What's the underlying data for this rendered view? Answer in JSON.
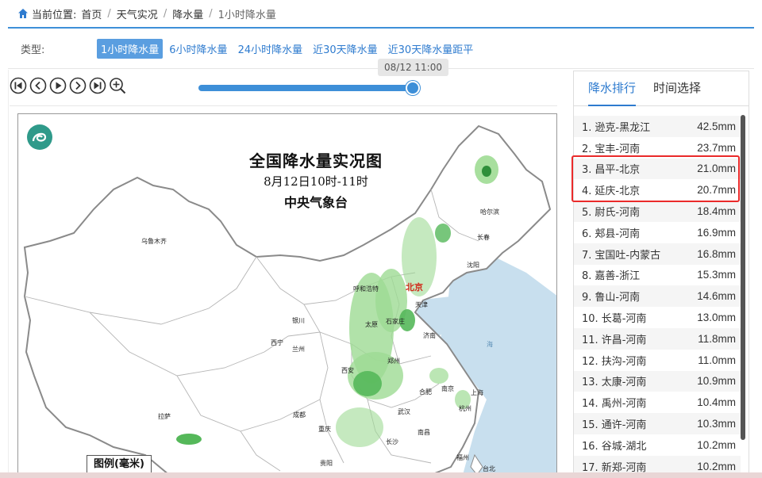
{
  "breadcrumb": {
    "prefix": "当前位置:",
    "items": [
      "首页",
      "天气实况",
      "降水量",
      "1小时降水量"
    ],
    "separator": "/"
  },
  "types": {
    "label": "类型:",
    "options": [
      "1小时降水量",
      "6小时降水量",
      "24小时降水量",
      "近30天降水量",
      "近30天降水量距平"
    ],
    "active_index": 0
  },
  "player": {
    "time_tip": "08/12 11:00",
    "slider_progress": 1.0
  },
  "map": {
    "title": "全国降水量实况图",
    "subtitle": "8月12日10时-11时",
    "agency": "中央气象台",
    "legend_title": "图例(毫米)",
    "cities": [
      "乌鲁木齐",
      "哈尔滨",
      "长春",
      "沈阳",
      "呼和浩特",
      "北京",
      "天津",
      "银川",
      "太原",
      "石家庄",
      "西宁",
      "兰州",
      "济南",
      "郑州",
      "西安",
      "合肥",
      "南京",
      "上海",
      "拉萨",
      "成都",
      "武汉",
      "杭州",
      "重庆",
      "长沙",
      "南昌",
      "贵阳",
      "福州",
      "台北"
    ],
    "capital": "北京",
    "sea_label": "海",
    "colors": {
      "rain_light": "#9edb94",
      "rain_mid": "#55b85a",
      "rain_dark": "#2f8f3a",
      "sea": "#c8dfee",
      "border": "#8a8a8a"
    }
  },
  "panel": {
    "tabs": [
      "降水排行",
      "时间选择"
    ],
    "active_tab": 0,
    "ranking": [
      {
        "rank": "1.",
        "station": "逊克-黑龙江",
        "value": "42.5mm"
      },
      {
        "rank": "2.",
        "station": "宝丰-河南",
        "value": "23.7mm"
      },
      {
        "rank": "3.",
        "station": "昌平-北京",
        "value": "21.0mm"
      },
      {
        "rank": "4.",
        "station": "延庆-北京",
        "value": "20.7mm"
      },
      {
        "rank": "5.",
        "station": "尉氏-河南",
        "value": "18.4mm"
      },
      {
        "rank": "6.",
        "station": "郏县-河南",
        "value": "16.9mm"
      },
      {
        "rank": "7.",
        "station": "宝国吐-内蒙古",
        "value": "16.8mm"
      },
      {
        "rank": "8.",
        "station": "嘉善-浙江",
        "value": "15.3mm"
      },
      {
        "rank": "9.",
        "station": "鲁山-河南",
        "value": "14.6mm"
      },
      {
        "rank": "10.",
        "station": "长葛-河南",
        "value": "13.0mm"
      },
      {
        "rank": "11.",
        "station": "许昌-河南",
        "value": "11.8mm"
      },
      {
        "rank": "12.",
        "station": "扶沟-河南",
        "value": "11.0mm"
      },
      {
        "rank": "13.",
        "station": "太康-河南",
        "value": "10.9mm"
      },
      {
        "rank": "14.",
        "station": "禹州-河南",
        "value": "10.4mm"
      },
      {
        "rank": "15.",
        "station": "通许-河南",
        "value": "10.3mm"
      },
      {
        "rank": "16.",
        "station": "谷城-湖北",
        "value": "10.2mm"
      },
      {
        "rank": "17.",
        "station": "新郑-河南",
        "value": "10.2mm"
      }
    ]
  },
  "accent_color": "#3d8fd8",
  "highlight_color": "#ea2a2a"
}
